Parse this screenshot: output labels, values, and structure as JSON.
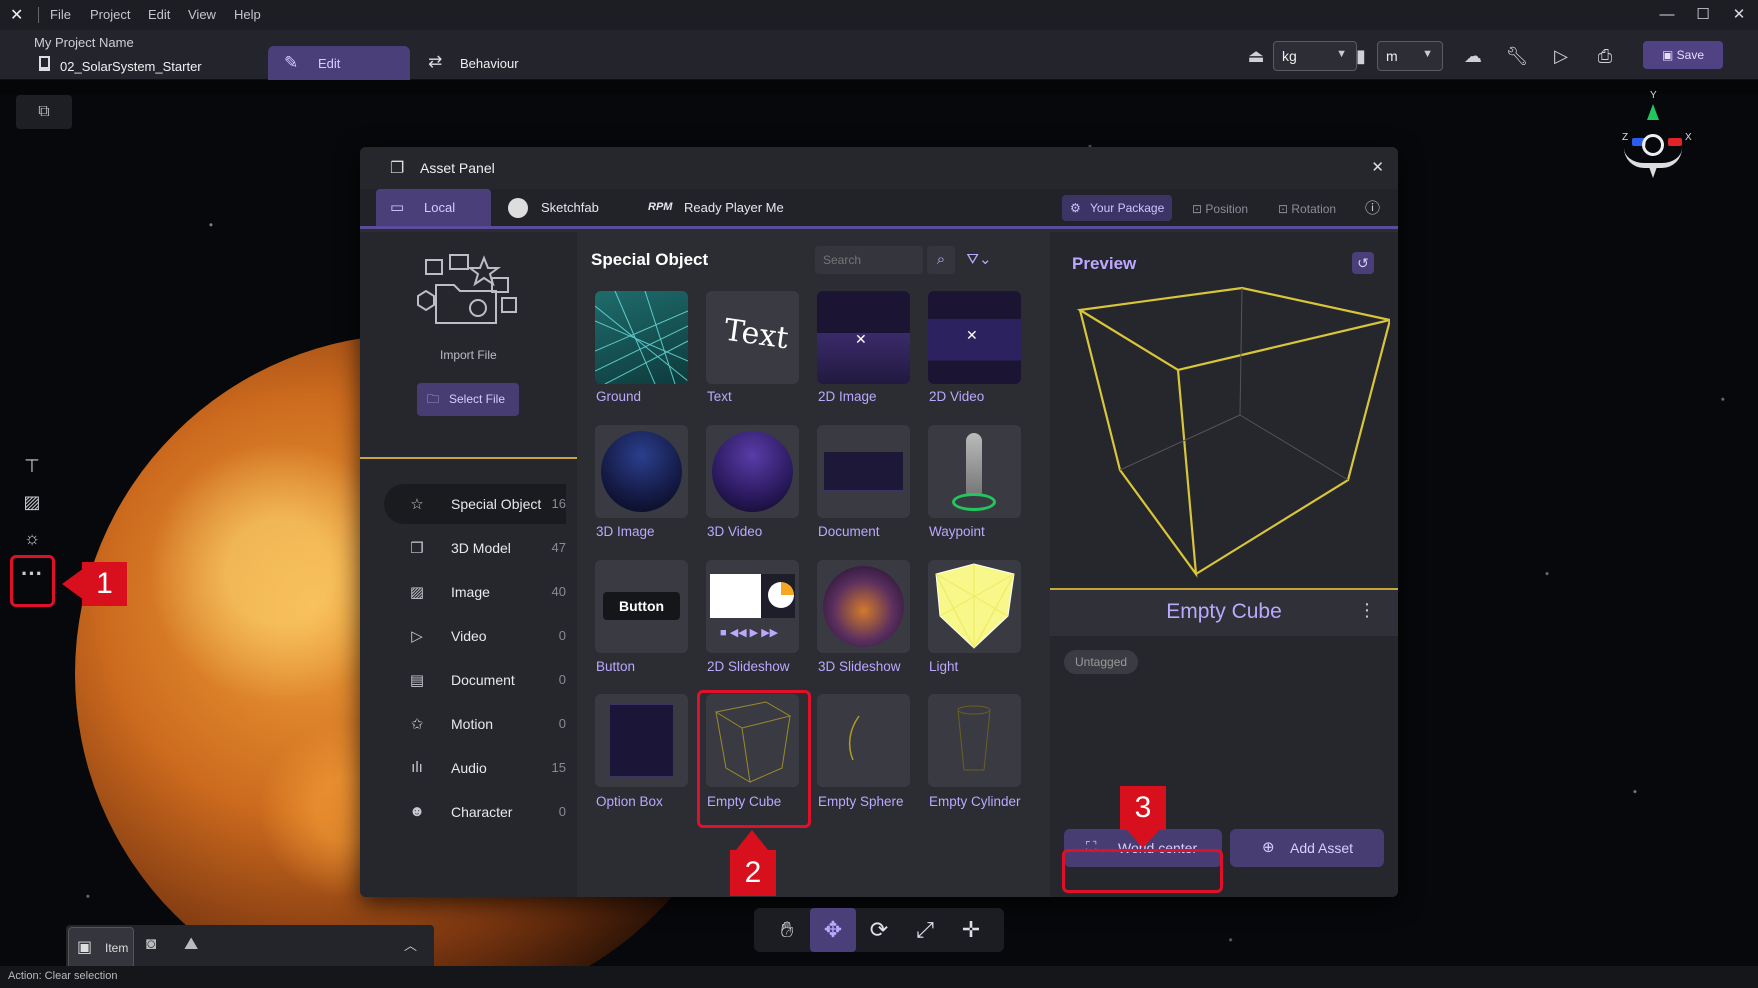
{
  "menu": [
    "File",
    "Project",
    "Edit",
    "View",
    "Help"
  ],
  "project": {
    "name_label": "My Project Name",
    "file": "02_SolarSystem_Starter"
  },
  "mode_tabs": {
    "edit": "Edit",
    "behaviour": "Behaviour"
  },
  "units": {
    "mass": "kg",
    "length": "m"
  },
  "save_label": "Save",
  "gizmo": {
    "y": "Y",
    "z": "Z",
    "x": "X"
  },
  "asset_panel": {
    "title": "Asset Panel",
    "tabs": [
      "Local",
      "Sketchfab",
      "Ready Player Me"
    ],
    "right_tabs": {
      "package": "Your Package",
      "position": "Position",
      "rotation": "Rotation"
    },
    "import_label": "Import File",
    "select_file": "Select File",
    "categories": [
      {
        "label": "Special Object",
        "count": "16"
      },
      {
        "label": "3D Model",
        "count": "47"
      },
      {
        "label": "Image",
        "count": "40"
      },
      {
        "label": "Video",
        "count": "0"
      },
      {
        "label": "Document",
        "count": "0"
      },
      {
        "label": "Motion",
        "count": "0"
      },
      {
        "label": "Audio",
        "count": "15"
      },
      {
        "label": "Character",
        "count": "0"
      }
    ],
    "section_title": "Special Object",
    "search_placeholder": "Search",
    "tiles": [
      "Ground",
      "Text",
      "2D Image",
      "2D Video",
      "3D Image",
      "3D Video",
      "Document",
      "Waypoint",
      "Button",
      "2D Slideshow",
      "3D Slideshow",
      "Light",
      "Option Box",
      "Empty Cube",
      "Empty Sphere",
      "Empty Cylinder"
    ],
    "tile_texts": {
      "text_thumb": "Text",
      "button_thumb": "Button"
    },
    "preview_title": "Preview",
    "selected_name": "Empty Cube",
    "tag": "Untagged",
    "world_center": "World center",
    "add_asset": "Add Asset"
  },
  "callouts": [
    "1",
    "2",
    "3"
  ],
  "bottom_tab": "Item",
  "status": "Action: Clear selection",
  "colors": {
    "accent": "#4a3f79",
    "highlight": "#e0102a",
    "tile_label": "#bba8ff"
  }
}
